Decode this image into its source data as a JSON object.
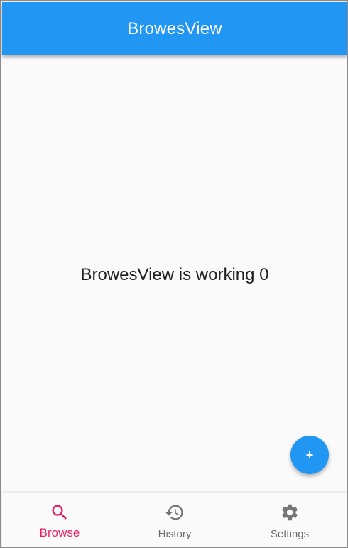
{
  "colors": {
    "primary": "#2196f3",
    "accent": "#e91e63",
    "inactive": "#757575"
  },
  "app_bar": {
    "title": "BrowesView"
  },
  "main": {
    "status_text": "BrowesView is working 0"
  },
  "fab": {
    "label": "+",
    "icon": "plus-icon"
  },
  "bottom_nav": {
    "selected_index": 0,
    "items": [
      {
        "label": "Browse",
        "icon": "search-icon"
      },
      {
        "label": "History",
        "icon": "history-icon"
      },
      {
        "label": "Settings",
        "icon": "gear-icon"
      }
    ]
  }
}
